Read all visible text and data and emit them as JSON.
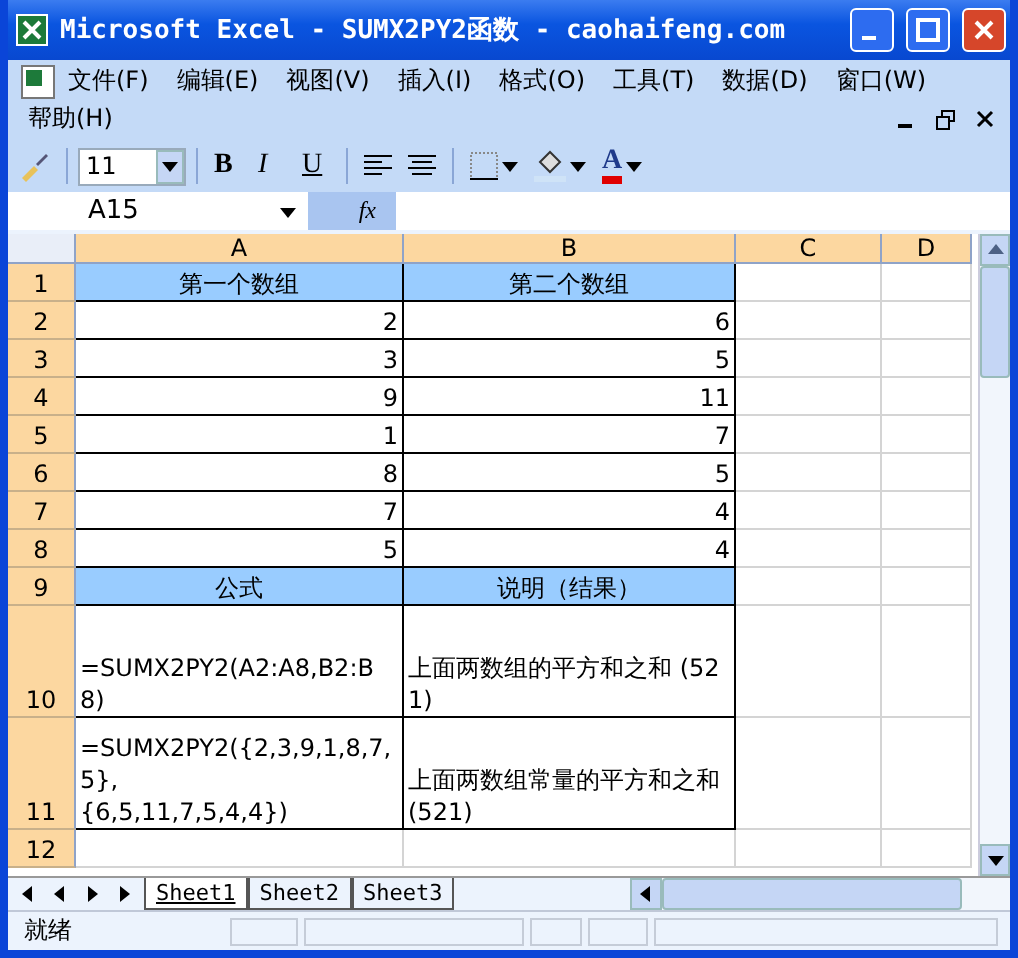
{
  "window": {
    "title": "Microsoft Excel - SUMX2PY2函数 - caohaifeng.com"
  },
  "menu": [
    "文件(F)",
    "编辑(E)",
    "视图(V)",
    "插入(I)",
    "格式(O)",
    "工具(T)",
    "数据(D)",
    "窗口(W)",
    "帮助(H)"
  ],
  "toolbar": {
    "font_size": "11",
    "bold": "B",
    "italic": "I",
    "underline": "U",
    "font_color": "A"
  },
  "formula_bar": {
    "name_box": "A15",
    "fx": "fx"
  },
  "columns": [
    "A",
    "B",
    "C",
    "D"
  ],
  "rows": [
    {
      "number": "1",
      "cells": [
        {
          "text": "第一个数组",
          "kind": "header"
        },
        {
          "text": "第二个数组",
          "kind": "header"
        }
      ]
    },
    {
      "number": "2",
      "cells": [
        {
          "text": "2",
          "kind": "number"
        },
        {
          "text": "6",
          "kind": "number"
        }
      ]
    },
    {
      "number": "3",
      "cells": [
        {
          "text": "3",
          "kind": "number"
        },
        {
          "text": "5",
          "kind": "number"
        }
      ]
    },
    {
      "number": "4",
      "cells": [
        {
          "text": "9",
          "kind": "number"
        },
        {
          "text": "11",
          "kind": "number"
        }
      ]
    },
    {
      "number": "5",
      "cells": [
        {
          "text": "1",
          "kind": "number"
        },
        {
          "text": "7",
          "kind": "number"
        }
      ]
    },
    {
      "number": "6",
      "cells": [
        {
          "text": "8",
          "kind": "number"
        },
        {
          "text": "5",
          "kind": "number"
        }
      ]
    },
    {
      "number": "7",
      "cells": [
        {
          "text": "7",
          "kind": "number"
        },
        {
          "text": "4",
          "kind": "number"
        }
      ]
    },
    {
      "number": "8",
      "cells": [
        {
          "text": "5",
          "kind": "number"
        },
        {
          "text": "4",
          "kind": "number"
        }
      ]
    },
    {
      "number": "9",
      "cells": [
        {
          "text": "公式",
          "kind": "header"
        },
        {
          "text": "说明（结果）",
          "kind": "header"
        }
      ]
    },
    {
      "number": "10",
      "cells": [
        {
          "text": "=SUMX2PY2(A2:A8,B2:B8)",
          "kind": "text"
        },
        {
          "text": "上面两数组的平方和之和 (521)",
          "kind": "text"
        }
      ]
    },
    {
      "number": "11",
      "cells": [
        {
          "text": "=SUMX2PY2({2,3,9,1,8,7,5},\n{6,5,11,7,5,4,4})",
          "kind": "text"
        },
        {
          "text": "上面两数组常量的平方和之和 (521)",
          "kind": "text"
        }
      ]
    },
    {
      "number": "12",
      "cells": []
    }
  ],
  "sheets": [
    {
      "label": "Sheet1",
      "selected": true
    },
    {
      "label": "Sheet2",
      "selected": false
    },
    {
      "label": "Sheet3",
      "selected": false
    }
  ],
  "status_bar": {
    "text": "就绪"
  }
}
